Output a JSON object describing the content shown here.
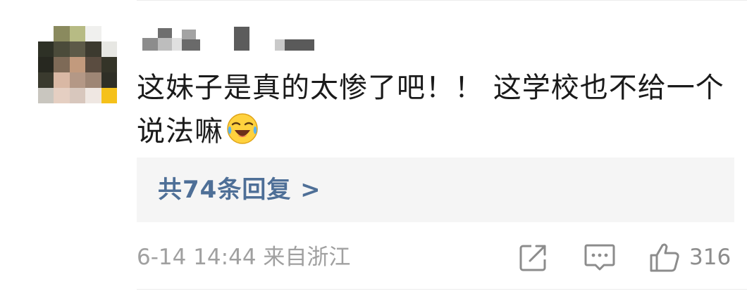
{
  "comment": {
    "text": "这妹子是真的太惨了吧！！ 这学校也不给一个说法嘛",
    "emoji": "laughing-crying-emoji"
  },
  "replies": {
    "label": "共74条回复 >"
  },
  "meta": {
    "time_location": "6-14 14:44 来自浙江"
  },
  "actions": {
    "share_icon": "share-icon",
    "comment_icon": "comment-icon",
    "like_icon": "thumbs-up-icon",
    "like_count": "316"
  },
  "colors": {
    "text": "#1a1a1a",
    "link": "#4e6f97",
    "meta": "#a0a0a0",
    "reply_bg": "#f5f5f5"
  }
}
